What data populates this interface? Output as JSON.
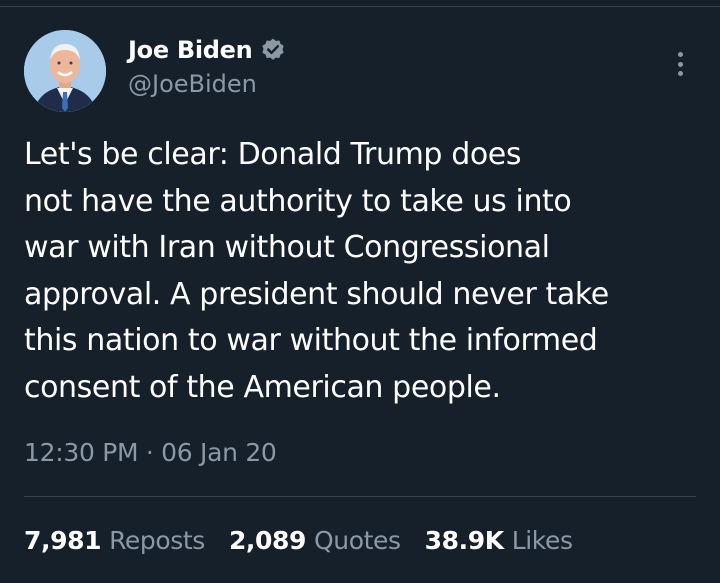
{
  "author": {
    "display_name": "Joe Biden",
    "handle": "@JoeBiden",
    "verified_icon": "verified-badge-icon",
    "verified_color": "#8b98a5"
  },
  "tweet": {
    "text": "Let's be clear: Donald Trump does\nnot have the authority to take us into\nwar with Iran without Congressional\napproval. A president should never take\nthis nation to war without the informed\nconsent of the American people.",
    "timestamp": "12:30 PM · 06 Jan 20"
  },
  "stats": [
    {
      "count": "7,981",
      "label": "Reposts"
    },
    {
      "count": "2,089",
      "label": "Quotes"
    },
    {
      "count": "38.9K",
      "label": "Likes"
    }
  ],
  "menu": {
    "icon": "more-options-icon"
  },
  "colors": {
    "background": "#15202b",
    "primary_text": "#ffffff",
    "secondary_text": "#8b98a5",
    "divider": "#38444d"
  }
}
